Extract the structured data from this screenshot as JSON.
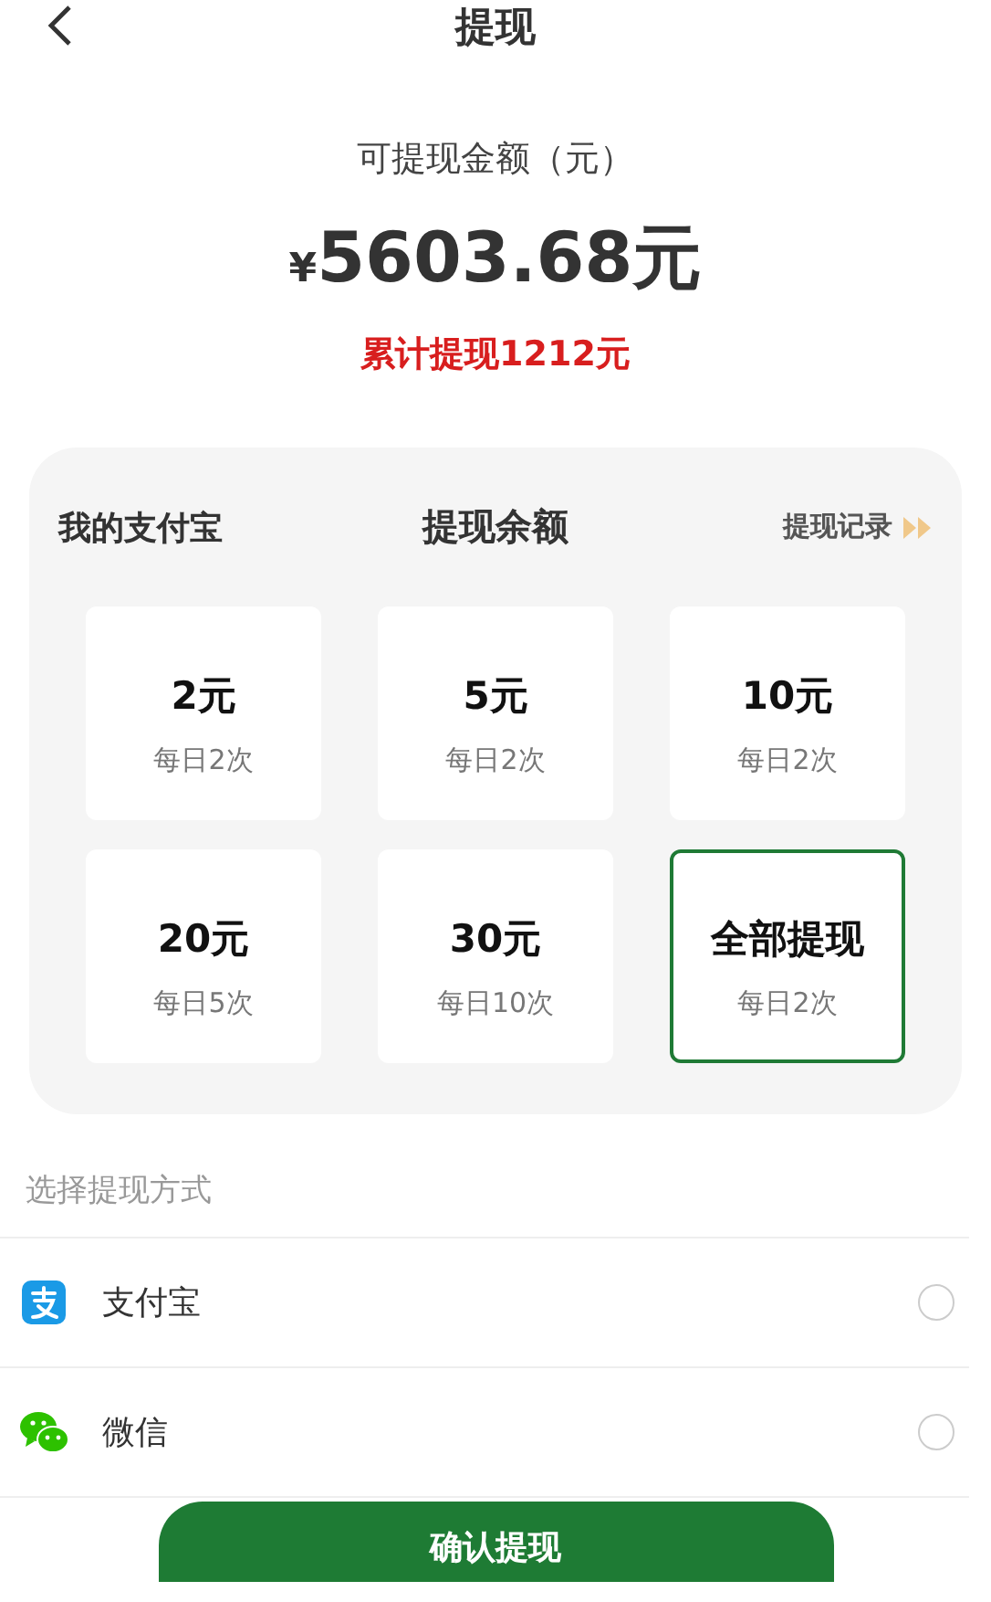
{
  "header": {
    "title": "提现"
  },
  "balance": {
    "label": "可提现金额（元）",
    "currency": "¥",
    "amount": "5603.68元",
    "total_withdrawn": "累计提现1212元"
  },
  "card": {
    "left_label": "我的支付宝",
    "title": "提现余额",
    "record_link": "提现记录",
    "options": [
      {
        "amount": "2元",
        "limit": "每日2次",
        "selected": false
      },
      {
        "amount": "5元",
        "limit": "每日2次",
        "selected": false
      },
      {
        "amount": "10元",
        "limit": "每日2次",
        "selected": false
      },
      {
        "amount": "20元",
        "limit": "每日5次",
        "selected": false
      },
      {
        "amount": "30元",
        "limit": "每日10次",
        "selected": false
      },
      {
        "amount": "全部提现",
        "limit": "每日2次",
        "selected": true
      }
    ]
  },
  "methods_heading": "选择提现方式",
  "methods": [
    {
      "kind": "alipay",
      "label": "支付宝",
      "selected": false
    },
    {
      "kind": "wechat",
      "label": "微信",
      "selected": false
    }
  ],
  "confirm_button": "确认提现"
}
